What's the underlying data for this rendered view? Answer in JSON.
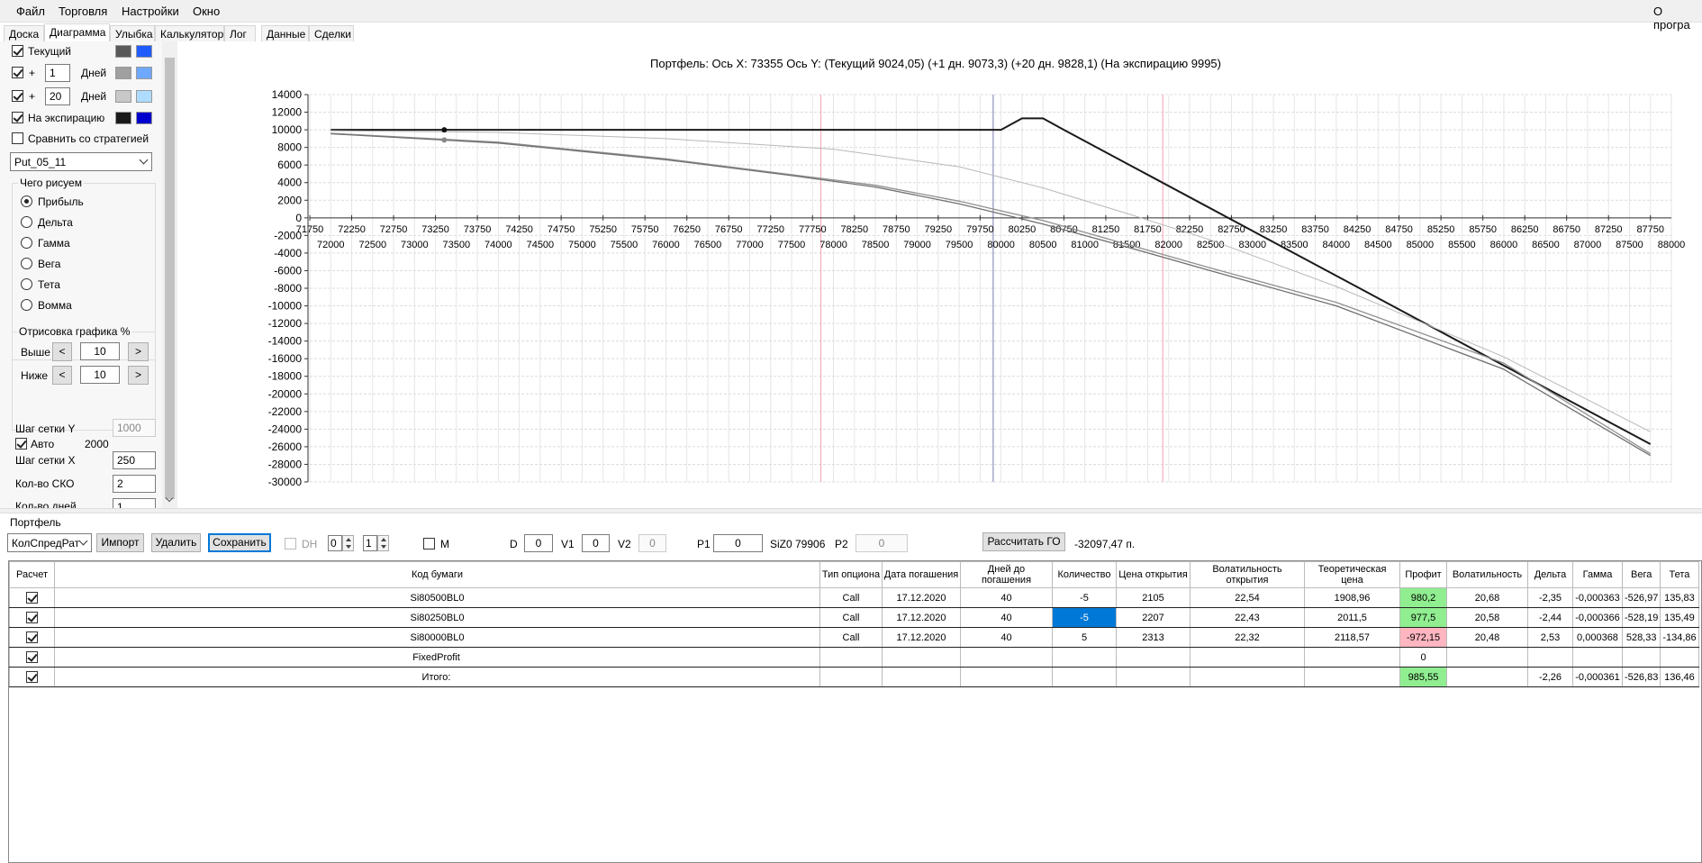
{
  "menu": {
    "items": [
      "Файл",
      "Торговля",
      "Настройки",
      "Окно"
    ],
    "right": "О програ"
  },
  "tabs": [
    "Доска",
    "Диаграмма",
    "Улыбка",
    "Калькулятор",
    "Лог",
    "Данные",
    "Сделки"
  ],
  "left": {
    "current_label": "Текущий",
    "plus": "+",
    "days1": "1",
    "days2": "20",
    "days_label": "Дней",
    "expiry_label": "На экспирацию",
    "compare_label": "Сравнить со стратегией",
    "strategy": "Put_05_11",
    "draw_group": "Чего рисуем",
    "radios": [
      "Прибыль",
      "Дельта",
      "Гамма",
      "Вега",
      "Тета",
      "Вомма"
    ],
    "render_group": "Отрисовка графика %",
    "above_label": "Выше",
    "below_label": "Ниже",
    "above_value": "10",
    "below_value": "10",
    "lt": "<",
    "gt": ">",
    "grid_y_label": "Шаг сетки Y",
    "grid_y_value": "1000",
    "auto_label": "Авто",
    "auto_value": "2000",
    "grid_x_label": "Шаг сетки X",
    "grid_x_value": "250",
    "sko_label": "Кол-во СКО",
    "sko_value": "2",
    "days_cut_label": "Кол-во дней",
    "days_cut_value": "1"
  },
  "colors": {
    "current_dark": "#595959",
    "current_blue": "#1f5cff",
    "d1_gray": "#a0a0a0",
    "d1_blue": "#6fa8ff",
    "d20_gray": "#c8c8c8",
    "d20_blue": "#aedcff",
    "exp_black": "#1a1a1a",
    "exp_blue": "#0000cc"
  },
  "chart_title": "Портфель: Ось X: 73355 Ось Y:  (Текущий 9024,05)  (+1 дн. 9073,3)  (+20 дн. 9828,1)  (На экспирацию 9995)",
  "chart_data": {
    "type": "line",
    "title": "Портфель: Ось X: 73355 Ось Y:  (Текущий 9024,05)  (+1 дн. 9073,3)  (+20 дн. 9828,1)  (На экспирацию 9995)",
    "xlim": [
      71750,
      88000
    ],
    "ylim": [
      -30000,
      14000
    ],
    "x_ticks_top": [
      "71750",
      "72250",
      "72750",
      "73250",
      "73750",
      "74250",
      "74750",
      "75250",
      "75750",
      "76250",
      "76750",
      "77250",
      "77750",
      "78250",
      "78750",
      "79250",
      "79750",
      "80250",
      "80750",
      "81250",
      "81750",
      "82250",
      "82750",
      "83250",
      "83750",
      "84250",
      "84750",
      "85250",
      "85750",
      "86250",
      "86750",
      "87250",
      "87750"
    ],
    "x_ticks_bottom": [
      "72000",
      "72500",
      "73000",
      "73500",
      "74000",
      "74500",
      "75000",
      "75500",
      "76000",
      "76500",
      "77000",
      "77500",
      "78000",
      "78500",
      "79000",
      "79500",
      "80000",
      "80500",
      "81000",
      "81500",
      "82000",
      "82500",
      "83000",
      "83500",
      "84000",
      "84500",
      "85000",
      "85500",
      "86000",
      "86500",
      "87000",
      "87500",
      "88000"
    ],
    "y_ticks": [
      "14000",
      "12000",
      "10000",
      "8000",
      "6000",
      "4000",
      "2000",
      "0",
      "-2000",
      "-4000",
      "-6000",
      "-8000",
      "-10000",
      "-12000",
      "-14000",
      "-16000",
      "-18000",
      "-20000",
      "-22000",
      "-24000",
      "-26000",
      "-28000",
      "-30000"
    ],
    "current_x": 79906,
    "sko_lines": [
      77850,
      81930
    ],
    "marker_x": 73355,
    "grid": true,
    "series": [
      {
        "color": "#1a1a1a",
        "width": 2,
        "points": [
          [
            72000,
            10000
          ],
          [
            80000,
            10000
          ],
          [
            80250,
            11300
          ],
          [
            80500,
            11300
          ],
          [
            80750,
            9995
          ],
          [
            87750,
            -25700
          ]
        ]
      },
      {
        "color": "#b8b8b8",
        "width": 1,
        "points": [
          [
            72000,
            9900
          ],
          [
            74000,
            9700
          ],
          [
            76000,
            9000
          ],
          [
            78000,
            7800
          ],
          [
            79500,
            5800
          ],
          [
            80500,
            3400
          ],
          [
            81500,
            500
          ],
          [
            82500,
            -2500
          ],
          [
            84000,
            -7800
          ],
          [
            86000,
            -15800
          ],
          [
            87750,
            -24300
          ]
        ]
      },
      {
        "color": "#909090",
        "width": 1.3,
        "points": [
          [
            72000,
            9600
          ],
          [
            74000,
            8600
          ],
          [
            76000,
            6700
          ],
          [
            77500,
            4900
          ],
          [
            78500,
            3700
          ],
          [
            79500,
            1900
          ],
          [
            80500,
            -300
          ],
          [
            81500,
            -3000
          ],
          [
            82500,
            -5700
          ],
          [
            84000,
            -9600
          ],
          [
            86000,
            -16500
          ],
          [
            87750,
            -26800
          ]
        ]
      },
      {
        "color": "#707070",
        "width": 1.3,
        "points": [
          [
            72000,
            9550
          ],
          [
            74000,
            8500
          ],
          [
            76000,
            6600
          ],
          [
            77500,
            4800
          ],
          [
            78500,
            3500
          ],
          [
            79500,
            1600
          ],
          [
            80500,
            -700
          ],
          [
            81500,
            -3300
          ],
          [
            82500,
            -6000
          ],
          [
            84000,
            -10000
          ],
          [
            86000,
            -17200
          ],
          [
            87750,
            -27000
          ]
        ]
      }
    ]
  },
  "portfolio": {
    "label": "Портфель",
    "combo": "КолСпредРат",
    "import": "Импорт",
    "delete": "Удалить",
    "save": "Сохранить",
    "dh": "DH",
    "dh_a": "0",
    "dh_b": "1",
    "m": "M",
    "d_label": "D",
    "d_value": "0",
    "v1_label": "V1",
    "v1_value": "0",
    "v2_label": "V2",
    "v2_value": "0",
    "p1_label": "P1",
    "p1_value": "0",
    "si": "SiZ0 79906",
    "p2_label": "P2",
    "p2_value": "0",
    "calc": "Рассчитать ГО",
    "go_value": "-32097,47 п."
  },
  "table": {
    "headers": [
      "Расчет",
      "Код бумаги",
      "Тип опциона",
      "Дата погашения",
      "Дней до погашения",
      "Количество",
      "Цена открытия",
      "Волатильность открытия",
      "Теоретическая цена",
      "Профит",
      "Волатильность",
      "Дельта",
      "Гамма",
      "Вега",
      "Тета"
    ],
    "rows": [
      [
        "Si80500BL0",
        "Call",
        "17.12.2020",
        "40",
        "-5",
        "2105",
        "22,54",
        "1908,96",
        "980,2",
        "20,68",
        "-2,35",
        "-0,000363",
        "-526,97",
        "135,83"
      ],
      [
        "Si80250BL0",
        "Call",
        "17.12.2020",
        "40",
        "-5",
        "2207",
        "22,43",
        "2011,5",
        "977,5",
        "20,58",
        "-2,44",
        "-0,000366",
        "-528,19",
        "135,49"
      ],
      [
        "Si80000BL0",
        "Call",
        "17.12.2020",
        "40",
        "5",
        "2313",
        "22,32",
        "2118,57",
        "-972,15",
        "20,48",
        "2,53",
        "0,000368",
        "528,33",
        "-134,86"
      ],
      [
        "FixedProfit",
        "",
        "",
        "",
        "",
        "",
        "",
        "",
        "0",
        "",
        "",
        "",
        "",
        ""
      ],
      [
        "Итого:",
        "",
        "",
        "",
        "",
        "",
        "",
        "",
        "985,55",
        "",
        "-2,26",
        "-0,000361",
        "-526,83",
        "136,46"
      ]
    ]
  }
}
